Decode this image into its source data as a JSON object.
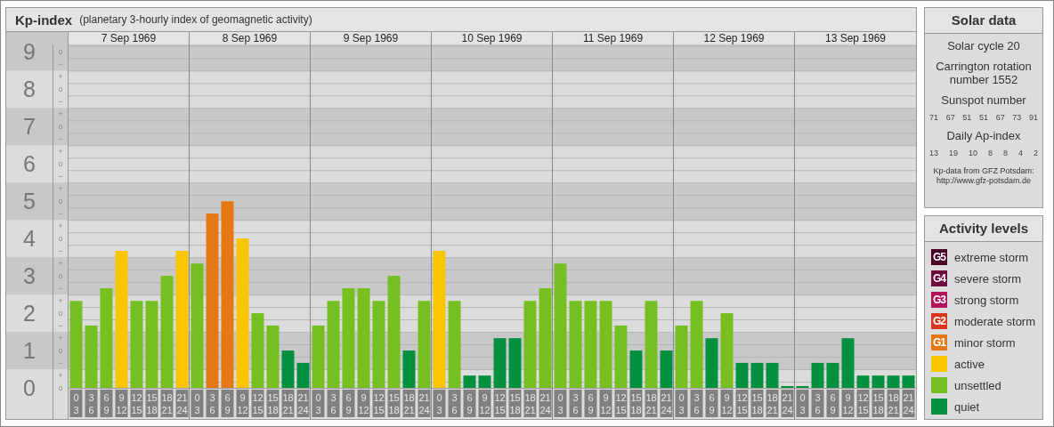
{
  "kp_panel": {
    "title": "Kp-index",
    "subtitle": "(planetary 3-hourly index of geomagnetic activity)",
    "days": [
      "7 Sep 1969",
      "8 Sep 1969",
      "9 Sep 1969",
      "10 Sep 1969",
      "11 Sep 1969",
      "12 Sep 1969",
      "13 Sep 1969"
    ],
    "step_marks": [
      {
        "zero": "o",
        "minus": "−"
      },
      {
        "plus": "+",
        "zero": "o",
        "minus": "−"
      },
      {
        "plus": "+",
        "zero": "o",
        "minus": "−"
      },
      {
        "plus": "+",
        "zero": "o",
        "minus": "−"
      },
      {
        "plus": "+",
        "zero": "o",
        "minus": "−"
      },
      {
        "plus": "+",
        "zero": "o",
        "minus": "−"
      },
      {
        "plus": "+",
        "zero": "o",
        "minus": "−"
      },
      {
        "plus": "+",
        "zero": "o",
        "minus": "−"
      },
      {
        "plus": "+",
        "zero": "o",
        "minus": "−"
      },
      {
        "plus": "+",
        "zero": "o"
      }
    ],
    "hour_labels": [
      {
        "from": "0",
        "to": "3"
      },
      {
        "from": "3",
        "to": "6"
      },
      {
        "from": "6",
        "to": "9"
      },
      {
        "from": "9",
        "to": "12"
      },
      {
        "from": "12",
        "to": "15"
      },
      {
        "from": "15",
        "to": "18"
      },
      {
        "from": "18",
        "to": "21"
      },
      {
        "from": "21",
        "to": "24"
      },
      {
        "from": "0",
        "to": "3"
      },
      {
        "from": "3",
        "to": "6"
      },
      {
        "from": "6",
        "to": "9"
      },
      {
        "from": "9",
        "to": "12"
      },
      {
        "from": "12",
        "to": "15"
      },
      {
        "from": "15",
        "to": "18"
      },
      {
        "from": "18",
        "to": "21"
      },
      {
        "from": "21",
        "to": "24"
      },
      {
        "from": "0",
        "to": "3"
      },
      {
        "from": "3",
        "to": "6"
      },
      {
        "from": "6",
        "to": "9"
      },
      {
        "from": "9",
        "to": "12"
      },
      {
        "from": "12",
        "to": "15"
      },
      {
        "from": "15",
        "to": "18"
      },
      {
        "from": "18",
        "to": "21"
      },
      {
        "from": "21",
        "to": "24"
      },
      {
        "from": "0",
        "to": "3"
      },
      {
        "from": "3",
        "to": "6"
      },
      {
        "from": "6",
        "to": "9"
      },
      {
        "from": "9",
        "to": "12"
      },
      {
        "from": "12",
        "to": "15"
      },
      {
        "from": "15",
        "to": "18"
      },
      {
        "from": "18",
        "to": "21"
      },
      {
        "from": "21",
        "to": "24"
      },
      {
        "from": "0",
        "to": "3"
      },
      {
        "from": "3",
        "to": "6"
      },
      {
        "from": "6",
        "to": "9"
      },
      {
        "from": "9",
        "to": "12"
      },
      {
        "from": "12",
        "to": "15"
      },
      {
        "from": "15",
        "to": "18"
      },
      {
        "from": "18",
        "to": "21"
      },
      {
        "from": "21",
        "to": "24"
      },
      {
        "from": "0",
        "to": "3"
      },
      {
        "from": "3",
        "to": "6"
      },
      {
        "from": "6",
        "to": "9"
      },
      {
        "from": "9",
        "to": "12"
      },
      {
        "from": "12",
        "to": "15"
      },
      {
        "from": "15",
        "to": "18"
      },
      {
        "from": "18",
        "to": "21"
      },
      {
        "from": "21",
        "to": "24"
      },
      {
        "from": "0",
        "to": "3"
      },
      {
        "from": "3",
        "to": "6"
      },
      {
        "from": "6",
        "to": "9"
      },
      {
        "from": "9",
        "to": "12"
      },
      {
        "from": "12",
        "to": "15"
      },
      {
        "from": "15",
        "to": "18"
      },
      {
        "from": "18",
        "to": "21"
      },
      {
        "from": "21",
        "to": "24"
      }
    ],
    "chart_data": {
      "type": "bar",
      "ylim": [
        0,
        9.2
      ],
      "grid": true,
      "yticks": [
        {
          "value": 0,
          "label": "0"
        },
        {
          "value": 1,
          "label": "1"
        },
        {
          "value": 2,
          "label": "2"
        },
        {
          "value": 3,
          "label": "3"
        },
        {
          "value": 4,
          "label": "4"
        },
        {
          "value": 5,
          "label": "5"
        },
        {
          "value": 6,
          "label": "6"
        },
        {
          "value": 7,
          "label": "7"
        },
        {
          "value": 8,
          "label": "8"
        },
        {
          "value": 9,
          "label": "9"
        }
      ],
      "series": [
        {
          "color": "#00903e",
          "values": [
            null,
            null,
            null,
            null,
            null,
            null,
            null,
            null,
            null,
            null,
            null,
            null,
            null,
            null,
            1,
            0.67,
            null,
            null,
            null,
            null,
            null,
            null,
            1,
            null,
            null,
            null,
            0.33,
            0.33,
            1.33,
            1.33,
            null,
            null,
            null,
            null,
            null,
            null,
            null,
            1,
            null,
            1,
            null,
            null,
            1.33,
            null,
            0.67,
            0.67,
            0.67,
            0,
            0,
            0.67,
            0.67,
            1.33,
            0.33,
            0.33,
            0.33,
            0.33
          ]
        },
        {
          "color": "#76bf21",
          "values": [
            2.33,
            1.67,
            2.67,
            null,
            2.33,
            2.33,
            3,
            null,
            3.33,
            null,
            null,
            null,
            2,
            1.67,
            null,
            null,
            1.67,
            2.33,
            2.67,
            2.67,
            2.33,
            3,
            null,
            2.33,
            null,
            2.33,
            null,
            null,
            null,
            null,
            2.33,
            2.67,
            3.33,
            2.33,
            2.33,
            2.33,
            1.67,
            null,
            2.33,
            null,
            1.67,
            2.33,
            null,
            2,
            null,
            null,
            null,
            null,
            null,
            null,
            null,
            null,
            null,
            null,
            null,
            null
          ]
        },
        {
          "color": "#f9c400",
          "values": [
            null,
            null,
            null,
            3.67,
            null,
            null,
            null,
            3.67,
            null,
            null,
            null,
            4,
            null,
            null,
            null,
            null,
            null,
            null,
            null,
            null,
            null,
            null,
            null,
            null,
            3.67,
            null,
            null,
            null,
            null,
            null,
            null,
            null,
            null,
            null,
            null,
            null,
            null,
            null,
            null,
            null,
            null,
            null,
            null,
            null,
            null,
            null,
            null,
            null,
            null,
            null,
            null,
            null,
            null,
            null,
            null,
            null
          ]
        },
        {
          "color": "#e47817",
          "values": [
            null,
            null,
            null,
            null,
            null,
            null,
            null,
            null,
            null,
            4.67,
            5,
            null,
            null,
            null,
            null,
            null,
            null,
            null,
            null,
            null,
            null,
            null,
            null,
            null,
            null,
            null,
            null,
            null,
            null,
            null,
            null,
            null,
            null,
            null,
            null,
            null,
            null,
            null,
            null,
            null,
            null,
            null,
            null,
            null,
            null,
            null,
            null,
            null,
            null,
            null,
            null,
            null,
            null,
            null,
            null,
            null
          ]
        }
      ]
    }
  },
  "solar_data": {
    "title": "Solar data",
    "cycle": "Solar cycle 20",
    "carrington": "Carrington rotation number 1552",
    "sunspot_label": "Sunspot number",
    "sunspot_numbers": [
      "71",
      "67",
      "51",
      "51",
      "67",
      "73",
      "91"
    ],
    "ap_label": "Daily Ap-index",
    "ap_values": [
      "13",
      "19",
      "10",
      "8",
      "8",
      "4",
      "2"
    ],
    "credit": "Kp-data from GFZ Potsdam: http://www.gfz-potsdam.de"
  },
  "activity_levels": {
    "title": "Activity levels",
    "items": [
      {
        "badge": "G5",
        "label": "extreme storm",
        "color": "#4a0028"
      },
      {
        "badge": "G4",
        "label": "severe storm",
        "color": "#6e0a3e"
      },
      {
        "badge": "G3",
        "label": "strong storm",
        "color": "#b0125c"
      },
      {
        "badge": "G2",
        "label": "moderate storm",
        "color": "#d9361e"
      },
      {
        "badge": "G1",
        "label": "minor storm",
        "color": "#e47817"
      },
      {
        "label": "active",
        "color": "#f9c400"
      },
      {
        "label": "unsettled",
        "color": "#76bf21"
      },
      {
        "label": "quiet",
        "color": "#00903e"
      }
    ]
  }
}
